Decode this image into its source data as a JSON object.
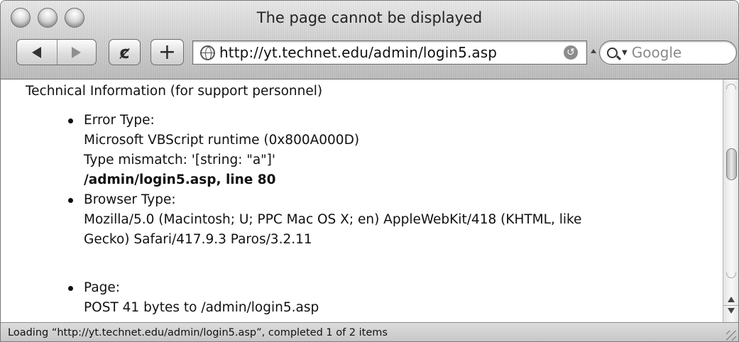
{
  "window": {
    "title": "The page cannot be displayed"
  },
  "toolbar": {
    "reload_glyph": "ȼ",
    "add_bookmark_glyph": "+",
    "back_icon": "back-arrow-icon",
    "forward_icon": "forward-arrow-icon"
  },
  "address_bar": {
    "url": "http://yt.technet.edu/admin/login5.asp"
  },
  "search": {
    "placeholder": "Google"
  },
  "page": {
    "header": "Technical Information (for support personnel)",
    "items": [
      {
        "label": "Error Type:",
        "lines": [
          "Microsoft VBScript runtime (0x800A000D)",
          "Type mismatch: '[string: \"a\"]'"
        ],
        "bold_line": "/admin/login5.asp, line 80"
      },
      {
        "label": "Browser Type:",
        "lines": [
          "Mozilla/5.0 (Macintosh; U; PPC Mac OS X; en) AppleWebKit/418 (KHTML, like",
          "Gecko) Safari/417.9.3 Paros/3.2.11"
        ]
      },
      {
        "label": "Page:",
        "lines": [
          "POST 41 bytes to /admin/login5.asp"
        ]
      }
    ]
  },
  "status_bar": {
    "text": "Loading “http://yt.technet.edu/admin/login5.asp”, completed 1 of 2 items"
  },
  "colors": {
    "chrome_light": "#e9e9e9",
    "chrome_dark": "#bdbdbd",
    "text": "#111111"
  }
}
